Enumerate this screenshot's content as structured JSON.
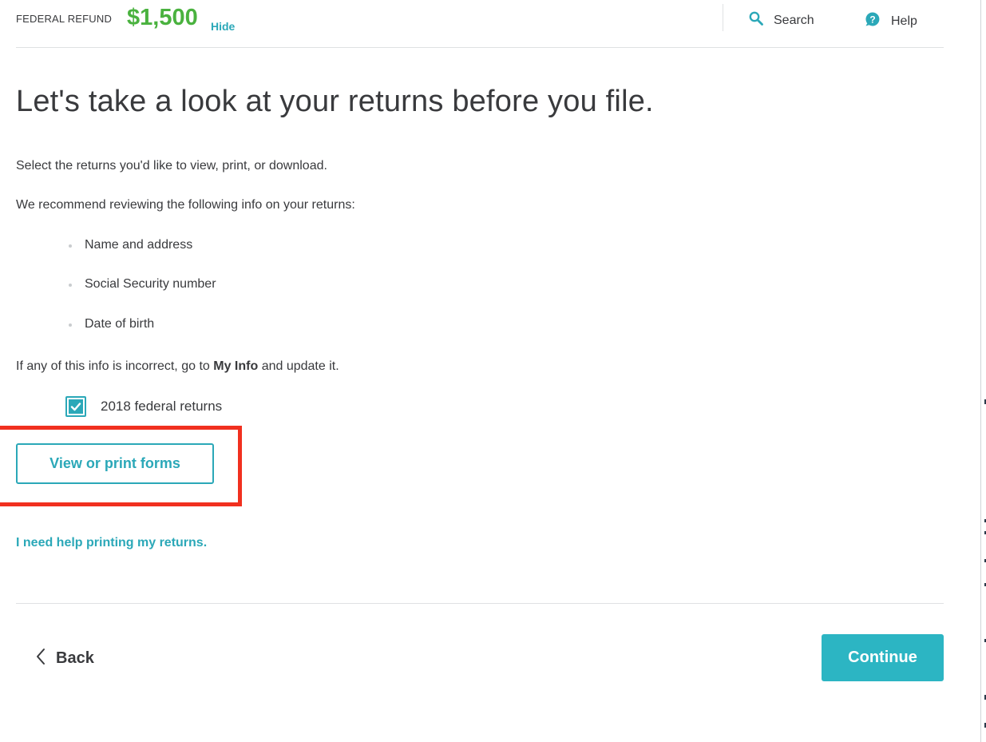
{
  "header": {
    "refund_label": "FEDERAL REFUND",
    "refund_amount": "$1,500",
    "hide_label": "Hide",
    "search_label": "Search",
    "help_label": "Help",
    "search_icon": "search-icon",
    "help_icon": "help-icon"
  },
  "main": {
    "title": "Let's take a look at your returns before you file.",
    "intro": "Select the returns you'd like to view, print, or download.",
    "recommend": "We recommend reviewing the following info on your returns:",
    "review_items": [
      "Name and address",
      "Social Security number",
      "Date of birth"
    ],
    "incorrect_prefix": "If any of this info is incorrect, go to",
    "incorrect_link": "My Info",
    "incorrect_suffix": "and update it.",
    "checkbox_label": "2018 federal returns",
    "checkbox_checked": true,
    "view_button": "View or print forms",
    "help_link": "I need help printing my returns."
  },
  "footer": {
    "back_label": "Back",
    "continue_label": "Continue"
  },
  "colors": {
    "accent": "#2ba8b8",
    "refund_green": "#4ab23f",
    "continue_bg": "#2cb5c3",
    "highlight_red": "#f1301f",
    "text": "#393a3d"
  }
}
